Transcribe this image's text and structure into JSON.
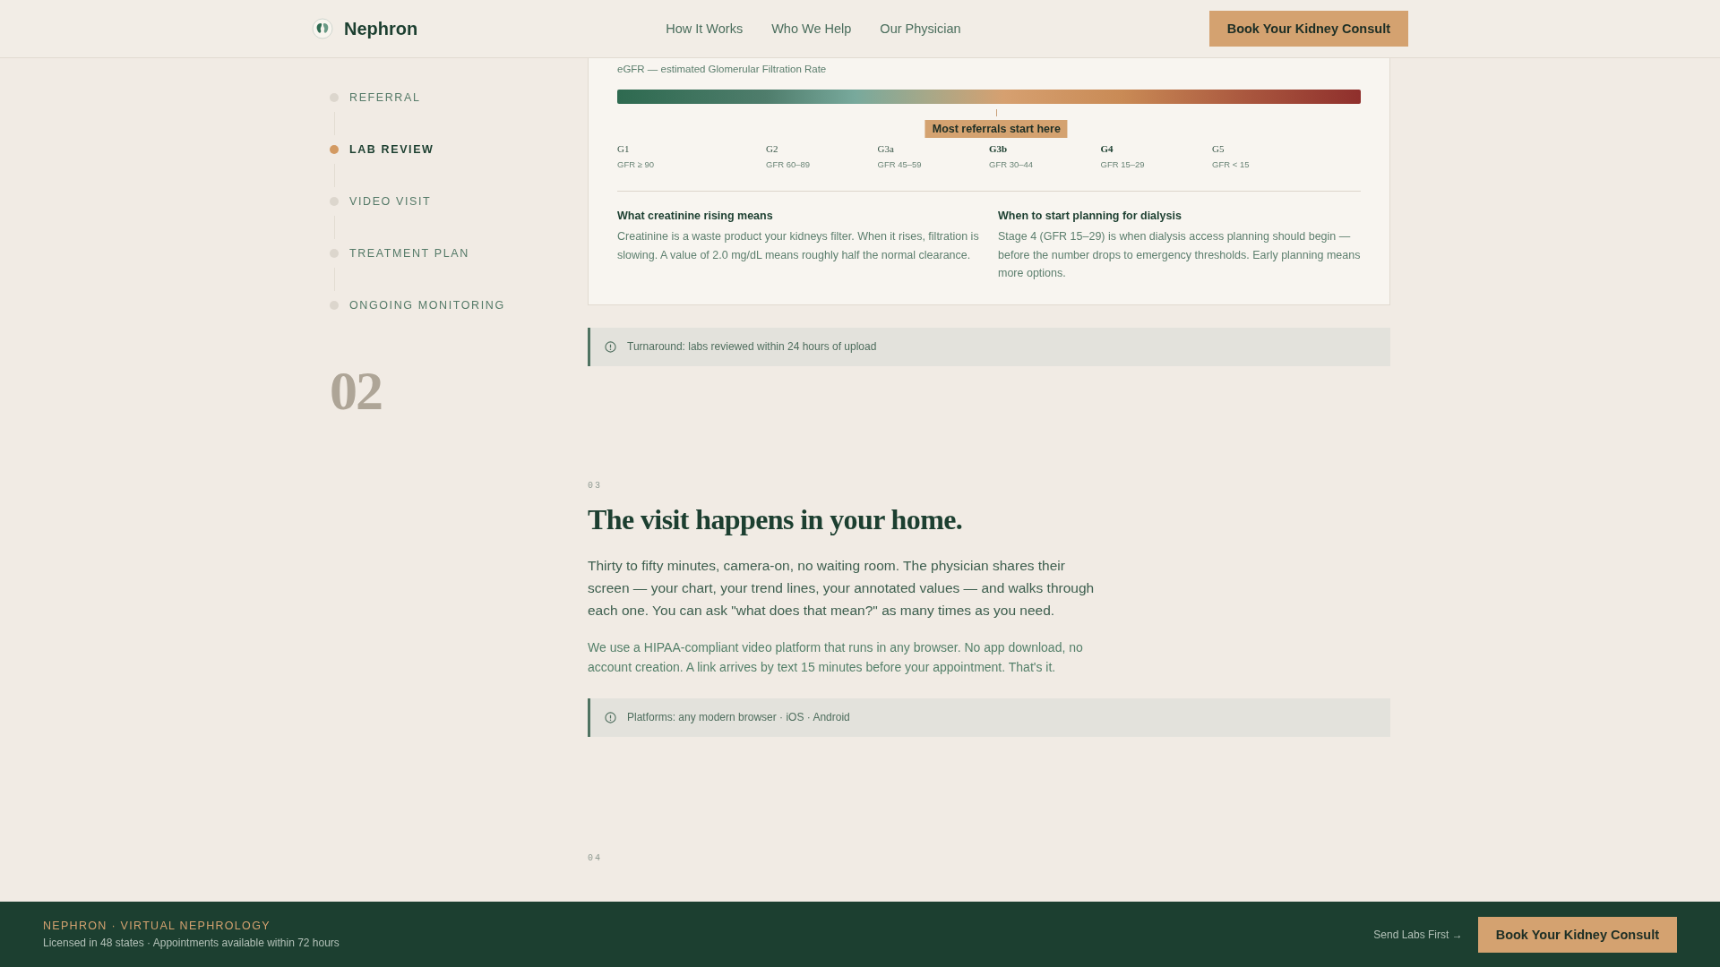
{
  "header": {
    "brand": "Nephron",
    "nav": [
      "How It Works",
      "Who We Help",
      "Our Physician"
    ],
    "cta": "Book Your Kidney Consult"
  },
  "sidebar": {
    "steps": [
      {
        "label": "REFERRAL",
        "selected": false
      },
      {
        "label": "LAB REVIEW",
        "selected": true
      },
      {
        "label": "VIDEO VISIT",
        "selected": false
      },
      {
        "label": "TREATMENT PLAN",
        "selected": false
      },
      {
        "label": "ONGOING MONITORING",
        "selected": false
      }
    ],
    "number": "02"
  },
  "egfr_card": {
    "caption": "eGFR — estimated Glomerular Filtration Rate",
    "marker": {
      "label": "Most referrals start here",
      "level": 0.51
    },
    "stages": [
      {
        "name": "G1",
        "range": "GFR ≥ 90",
        "highlight": false
      },
      {
        "name": "G2",
        "range": "GFR 60–89",
        "highlight": false
      },
      {
        "name": "G3a",
        "range": "GFR 45–59",
        "highlight": false
      },
      {
        "name": "G3b",
        "range": "GFR 30–44",
        "highlight": true
      },
      {
        "name": "G4",
        "range": "GFR 15–29",
        "highlight": true
      },
      {
        "name": "G5",
        "range": "GFR < 15",
        "highlight": false
      }
    ],
    "notes": [
      {
        "title": "What creatinine rising means",
        "text": "Creatinine is a waste product your kidneys filter. When it rises, filtration is slowing. A value of 2.0 mg/dL means roughly half the normal clearance."
      },
      {
        "title": "When to start planning for dialysis",
        "text": "Stage 4 (GFR 15–29) is when dialysis access planning should begin — before the number drops to emergency thresholds. Early planning means more options."
      }
    ]
  },
  "turnaround_note": "Turnaround: labs reviewed within 24 hours of upload",
  "section_03": {
    "number": "03",
    "heading": "The visit happens in your home.",
    "paragraphs": [
      "Thirty to fifty minutes, camera-on, no waiting room. The physician shares their screen — your chart, your trend lines, your annotated values — and walks through each one. You can ask \"what does that mean?\" as many times as you need.",
      "We use a HIPAA-compliant video platform that runs in any browser. No app download, no account creation. A link arrives by text 15 minutes before your appointment. That's it."
    ],
    "note": "Platforms: any modern browser · iOS · Android"
  },
  "section_04": {
    "number": "04"
  },
  "footer": {
    "brand": "NEPHRON · VIRTUAL NEPHROLOGY",
    "subline": "Licensed in 48 states · Appointments available within 72 hours",
    "link": "Send Labs First →",
    "cta": "Book Your Kidney Consult"
  }
}
